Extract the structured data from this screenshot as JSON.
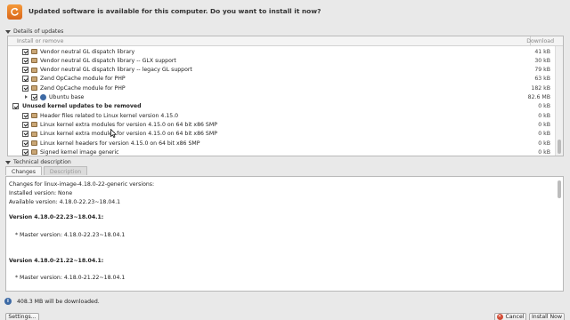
{
  "header": {
    "icon": "refresh-icon",
    "message": "Updated software is available for this computer. Do you want to install it now?"
  },
  "details": {
    "toggle_label": "Details of updates",
    "columns": {
      "name": "Install or remove",
      "download": "Download"
    },
    "rows": [
      {
        "kind": "item",
        "icon": "package-icon",
        "label": "Vendor neutral GL dispatch library",
        "size": "41 kB"
      },
      {
        "kind": "item",
        "icon": "package-icon",
        "label": "Vendor neutral GL dispatch library -- GLX support",
        "size": "30 kB"
      },
      {
        "kind": "item",
        "icon": "package-icon",
        "label": "Vendor neutral GL dispatch library -- legacy GL support",
        "size": "79 kB"
      },
      {
        "kind": "item",
        "icon": "package-icon",
        "label": "Zend OpCache module for PHP",
        "size": "63 kB"
      },
      {
        "kind": "item",
        "icon": "package-icon",
        "label": "Zend OpCache module for PHP",
        "size": "182 kB"
      },
      {
        "kind": "item",
        "icon": "ubuntu-icon",
        "label": "Ubuntu base",
        "size": "82.6 MB"
      },
      {
        "kind": "group",
        "label": "Unused kernel updates to be removed",
        "size": "0 kB"
      },
      {
        "kind": "sub",
        "icon": "package-icon",
        "label": "Header files related to Linux kernel version 4.15.0",
        "size": "0 kB"
      },
      {
        "kind": "sub",
        "icon": "package-icon",
        "label": "Linux kernel extra modules for version 4.15.0 on 64 bit x86 SMP",
        "size": "0 kB"
      },
      {
        "kind": "sub",
        "icon": "package-icon",
        "label": "Linux kernel extra modules for version 4.15.0 on 64 bit x86 SMP",
        "size": "0 kB"
      },
      {
        "kind": "sub",
        "icon": "package-icon",
        "label": "Linux kernel headers for version 4.15.0 on 64 bit x86 SMP",
        "size": "0 kB"
      },
      {
        "kind": "sub",
        "icon": "package-icon",
        "label": "Signed kernel image generic",
        "size": "0 kB"
      }
    ]
  },
  "technical": {
    "toggle_label": "Technical description",
    "tabs": [
      "Changes",
      "Description"
    ],
    "active_tab": "Changes",
    "lines": [
      {
        "text": "Changes for linux-image-4.18.0-22-generic versions:",
        "style": "normal"
      },
      {
        "text": "Installed version: None",
        "style": "normal"
      },
      {
        "text": "Available version: 4.18.0-22.23~18.04.1",
        "style": "normal"
      },
      {
        "text": "Version 4.18.0-22.23~18.04.1:",
        "style": "bold"
      },
      {
        "text": "* Master version: 4.18.0-22.23~18.04.1",
        "style": "normal"
      },
      {
        "text": "Version 4.18.0-21.22~18.04.1:",
        "style": "bold"
      },
      {
        "text": "* Master version: 4.18.0-21.22~18.04.1",
        "style": "normal"
      }
    ]
  },
  "status": {
    "text": "408.3 MB will be downloaded."
  },
  "buttons": {
    "settings": "Settings...",
    "cancel": "Cancel",
    "install": "Install Now"
  },
  "colors": {
    "accent": "#3d6aa5",
    "icon_orange": "#e67e22",
    "cancel_red": "#d24b35"
  }
}
